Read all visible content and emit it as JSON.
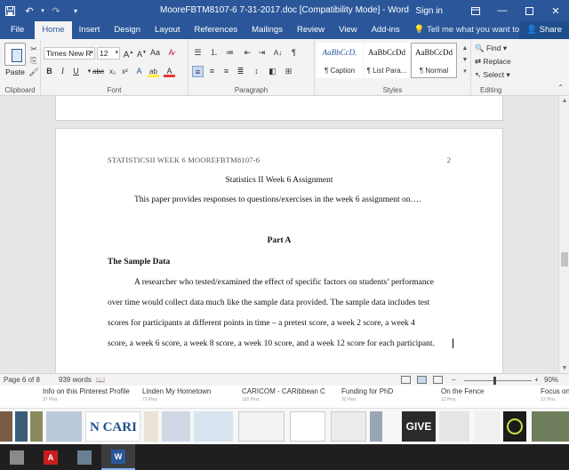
{
  "window": {
    "title": "MooreFBTM8107-6 7-31-2017.doc [Compatibility Mode] - Word",
    "sign_in": "Sign in",
    "share": "Share"
  },
  "tabs": [
    "File",
    "Home",
    "Insert",
    "Design",
    "Layout",
    "References",
    "Mailings",
    "Review",
    "View",
    "Add-ins"
  ],
  "tell_me": "Tell me what you want to do",
  "ribbon": {
    "clipboard": {
      "paste": "Paste",
      "label": "Clipboard"
    },
    "font": {
      "family": "Times New R",
      "size": "12",
      "label": "Font"
    },
    "paragraph": {
      "label": "Paragraph"
    },
    "styles": {
      "label": "Styles",
      "items": [
        {
          "sample": "AaBbCcD.",
          "name": "¶ Caption"
        },
        {
          "sample": "AaBbCcDd",
          "name": "¶ List Para..."
        },
        {
          "sample": "AaBbCcDd",
          "name": "¶ Normal"
        }
      ]
    },
    "editing": {
      "find": "Find",
      "replace": "Replace",
      "select": "Select",
      "label": "Editing"
    }
  },
  "document": {
    "header": "STATISTICSII WEEK 6 MOOREFBTM8107-6",
    "page_number": "2",
    "title": "Statistics II Week 6 Assignment",
    "intro": "This paper provides responses to questions/exercises in the week 6 assignment on….",
    "part": "Part A",
    "section": "The Sample Data",
    "paragraph_lines": [
      "A researcher who tested/examined the effect of specific factors on students’ performance",
      "over time would collect data much like the sample data provided.  The sample data includes test",
      "scores for participants at different points in time – a pretest score, a week 2 score, a week 4",
      "score, a week 6 score, a week 8 score, a week 10 score, and a week 12 score for each participant."
    ]
  },
  "status": {
    "page": "Page 6 of 8",
    "words": "939 words",
    "zoom": "90%"
  },
  "pinterest": [
    {
      "title": "Info on this Pinterest Profile",
      "sub": "37 Pins"
    },
    {
      "title": "Linden My Hometown",
      "sub": "73 Pins"
    },
    {
      "title": "CARICOM - CARibbean C",
      "sub": "100 Pins"
    },
    {
      "title": "Funding for PhD",
      "sub": "32 Pins"
    },
    {
      "title": "On the Fence",
      "sub": "12 Pins"
    },
    {
      "title": "Focus on",
      "sub": "12 Pins"
    }
  ],
  "thumb_text": {
    "cari": "N CARI",
    "give": "GIVE"
  },
  "colors": {
    "word_blue": "#2b579a",
    "taskbar": "#1f1f1f"
  }
}
